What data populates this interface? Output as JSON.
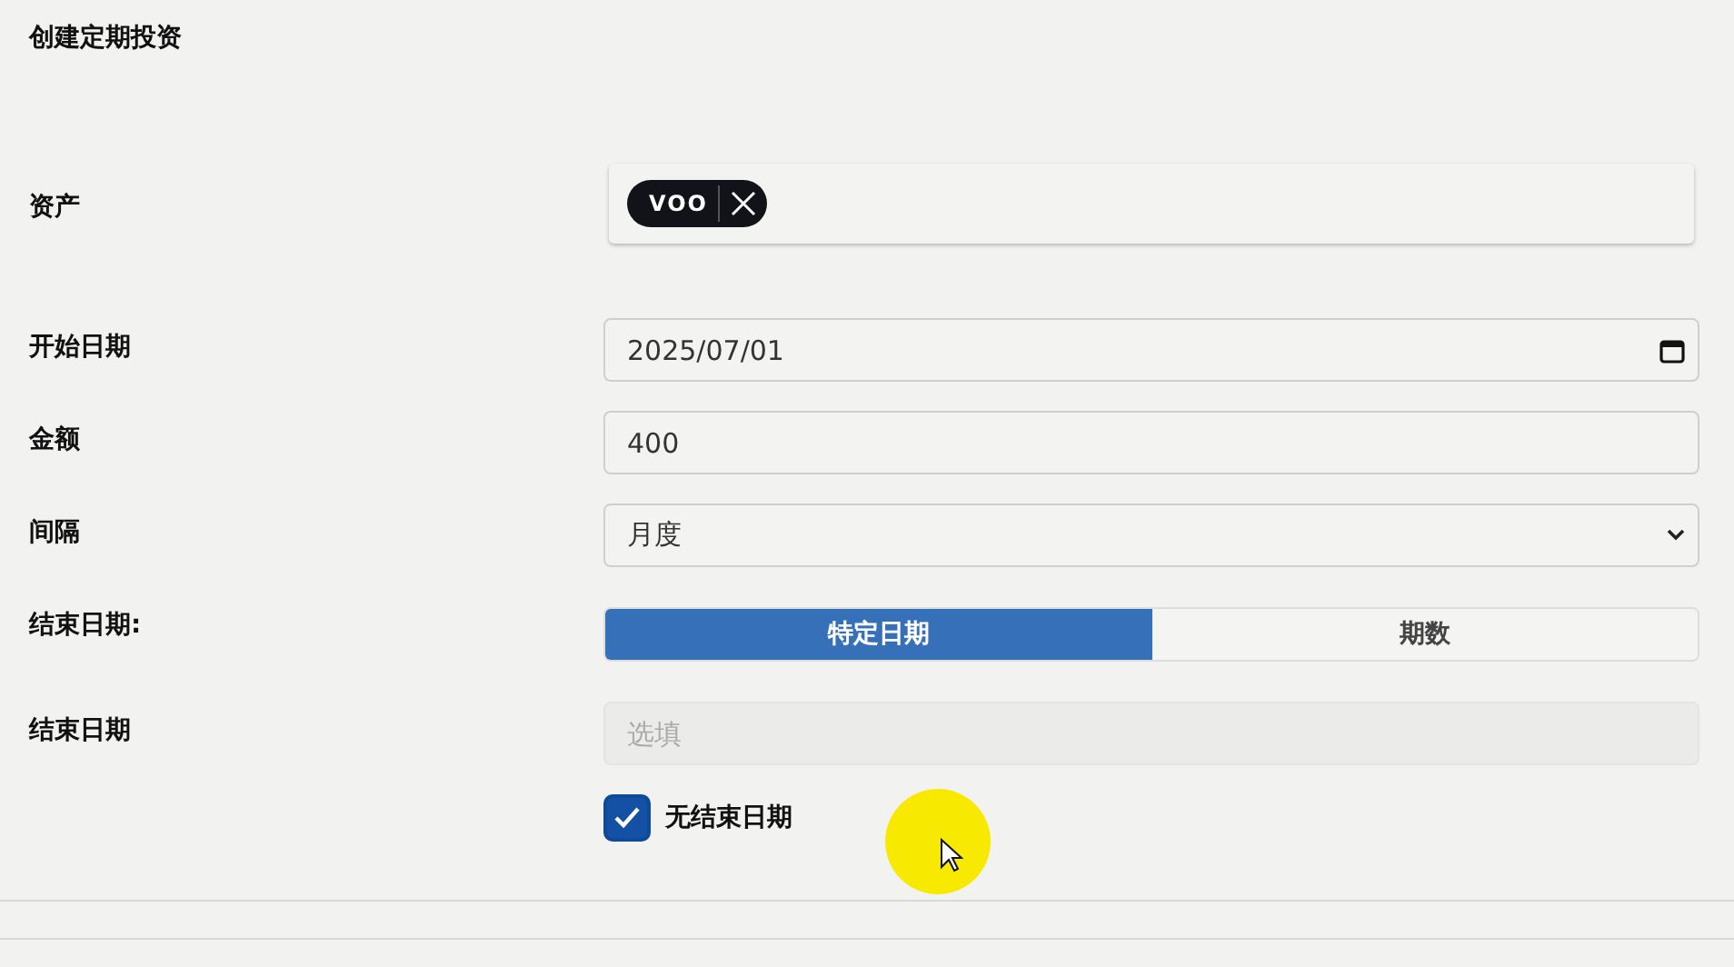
{
  "title": "创建定期投资",
  "fields": [
    {
      "kind": "tags",
      "label": "资产",
      "tags": [
        "VOO"
      ]
    },
    {
      "kind": "date",
      "label": "开始日期",
      "value": "2025/07/01"
    },
    {
      "kind": "text",
      "label": "金额",
      "value": "400"
    },
    {
      "kind": "select",
      "label": "间隔",
      "value": "月度"
    },
    {
      "kind": "toggle",
      "label": "结束日期:",
      "options": [
        {
          "label": "特定日期",
          "selected": true
        },
        {
          "label": "期数",
          "selected": false
        }
      ]
    },
    {
      "kind": "text",
      "label": "结束日期",
      "placeholder": "选填",
      "disabled": true
    },
    {
      "kind": "checkbox",
      "label": "无结束日期",
      "checked": true
    }
  ]
}
